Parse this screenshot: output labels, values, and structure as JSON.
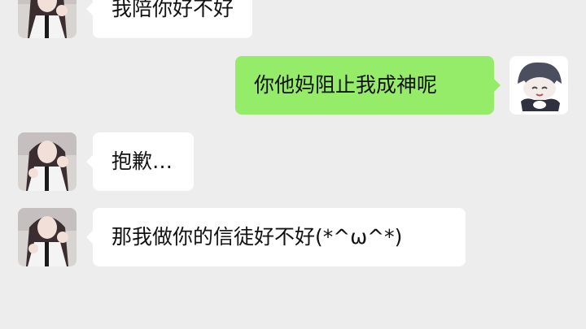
{
  "colors": {
    "background": "#ededed",
    "incoming_bubble": "#ffffff",
    "outgoing_bubble": "#95ec69",
    "text": "#111111"
  },
  "messages": [
    {
      "sender": "contact",
      "text": "我陪你好不好"
    },
    {
      "sender": "me",
      "text": "你他妈阻止我成神呢"
    },
    {
      "sender": "contact",
      "text": "抱歉…"
    },
    {
      "sender": "contact",
      "text": "那我做你的信徒好不好(*^ω^*)"
    }
  ]
}
